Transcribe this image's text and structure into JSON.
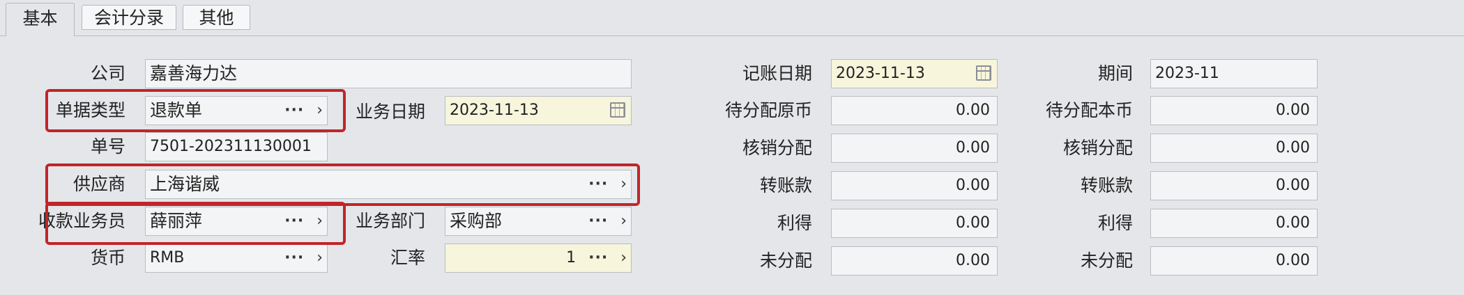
{
  "tabs": [
    "基本",
    "会计分录",
    "其他"
  ],
  "form": {
    "company": {
      "label": "公司",
      "value": "嘉善海力达"
    },
    "doc_type": {
      "label": "单据类型",
      "value": "退款单"
    },
    "biz_date": {
      "label": "业务日期",
      "value": "2023-11-13"
    },
    "doc_no": {
      "label": "单号",
      "value": "7501-202311130001"
    },
    "supplier": {
      "label": "供应商",
      "value": "上海谐威"
    },
    "collector": {
      "label": "收款业务员",
      "value": "薛丽萍"
    },
    "department": {
      "label": "业务部门",
      "value": "采购部"
    },
    "currency": {
      "label": "货币",
      "value": "RMB"
    },
    "rate": {
      "label": "汇率",
      "value": "1"
    },
    "post_date": {
      "label": "记账日期",
      "value": "2023-11-13"
    },
    "period": {
      "label": "期间",
      "value": "2023-11"
    },
    "left_col": [
      {
        "label": "待分配原币",
        "value": "0.00"
      },
      {
        "label": "核销分配",
        "value": "0.00"
      },
      {
        "label": "转账款",
        "value": "0.00"
      },
      {
        "label": "利得",
        "value": "0.00"
      },
      {
        "label": "未分配",
        "value": "0.00"
      }
    ],
    "right_col": [
      {
        "label": "待分配本币",
        "value": "0.00"
      },
      {
        "label": "核销分配",
        "value": "0.00"
      },
      {
        "label": "转账款",
        "value": "0.00"
      },
      {
        "label": "利得",
        "value": "0.00"
      },
      {
        "label": "未分配",
        "value": "0.00"
      }
    ]
  },
  "icons": {
    "lookup": "ellipsis-icon",
    "expand": "chevron-right-icon",
    "date": "calendar-icon"
  },
  "colors": {
    "highlight": "#c0252a",
    "date_field": "#f7f5dc",
    "background": "#e4e6e9"
  }
}
